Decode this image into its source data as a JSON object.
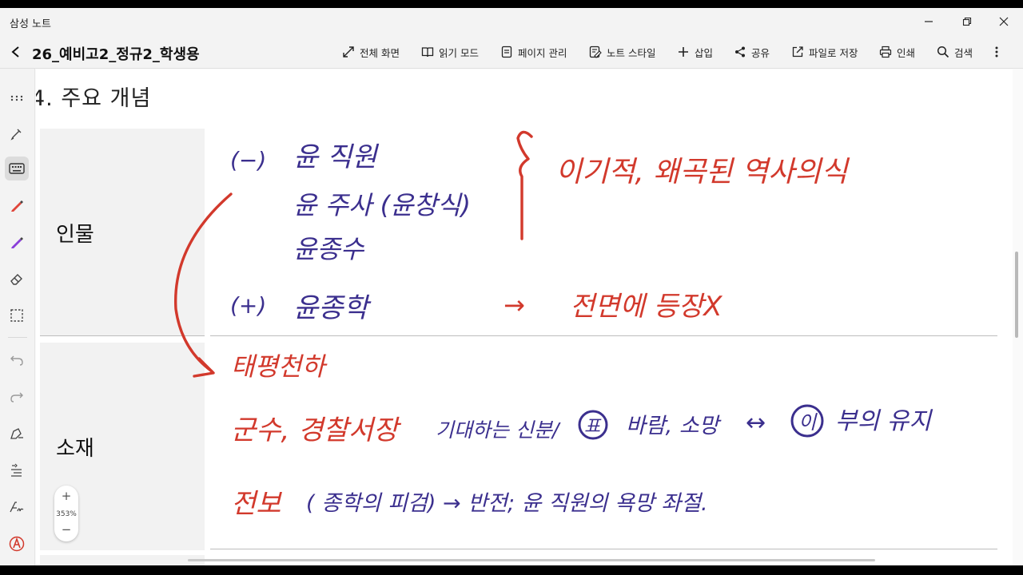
{
  "app": {
    "title": "삼성 노트"
  },
  "window": {
    "minimize": "minimize",
    "restore": "restore",
    "close": "close"
  },
  "toolbar": {
    "doc_title": "26_예비고2_정규2_학생용",
    "items": {
      "fullscreen": "전체 화면",
      "reading_mode": "읽기 모드",
      "page_manage": "페이지 관리",
      "note_style": "노트 스타일",
      "insert": "삽입",
      "share": "공유",
      "save_file": "파일로 저장",
      "print": "인쇄",
      "search": "검색"
    }
  },
  "zoom": {
    "level": "353%",
    "plus": "+",
    "minus": "−"
  },
  "note": {
    "heading": "4.  주요  개념",
    "rows": [
      {
        "label": "인물"
      },
      {
        "label": "소재"
      }
    ],
    "ink": {
      "minus_sign": "(−)",
      "plus_sign": "(+)",
      "char1": "윤 직원",
      "char2": "윤 주사 (윤창식)",
      "char3": "윤종수",
      "char4": "윤종학",
      "bracket_note": "이기적,  왜곡된  역사의식",
      "arrow_note": "전면에  등장X",
      "arrow_symbol": "→",
      "taepyeong": "태평천하",
      "gunsu": "군수,  경찰서장",
      "gunsu_note1": "기대하는  신분/",
      "gunsu_circle1": "표",
      "gunsu_note2": "바람, 소망",
      "gunsu_arrow": "↔",
      "gunsu_circle2": "이",
      "gunsu_note3": "부의 유지",
      "jeonbo": "전보",
      "jeonbo_note": "( 종학의 피검)  →  반전;  윤  직원의  욕망  좌절."
    }
  },
  "colors": {
    "ink_blue": "#3b2f8e",
    "ink_red": "#d2392c",
    "cell_bg": "#f2f2f2"
  }
}
